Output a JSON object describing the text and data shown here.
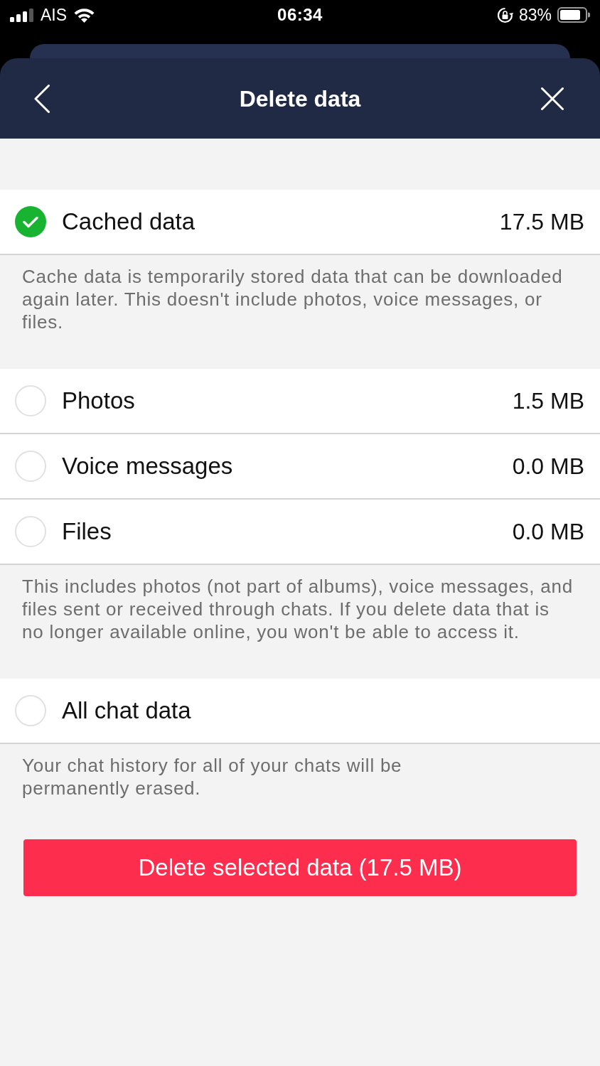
{
  "status_bar": {
    "carrier": "AIS",
    "time": "06:34",
    "battery": "83%"
  },
  "header": {
    "title": "Delete data"
  },
  "sections": [
    {
      "items": [
        {
          "label": "Cached data",
          "size": "17.5 MB",
          "checked": true
        }
      ],
      "note": "Cache data is temporarily stored data that can be downloaded again later. This doesn't include photos, voice messages, or files."
    },
    {
      "items": [
        {
          "label": "Photos",
          "size": "1.5 MB",
          "checked": false
        },
        {
          "label": "Voice messages",
          "size": "0.0 MB",
          "checked": false
        },
        {
          "label": "Files",
          "size": "0.0 MB",
          "checked": false
        }
      ],
      "note": "This includes photos (not part of albums), voice messages, and files sent or received through chats. If you delete data that is no longer available online, you won't be able to access it."
    },
    {
      "items": [
        {
          "label": "All chat data",
          "checked": false
        }
      ],
      "note": "Your chat history for all of your chats will be\npermanently erased."
    }
  ],
  "delete_button": {
    "label": "Delete selected data (17.5 MB)"
  }
}
